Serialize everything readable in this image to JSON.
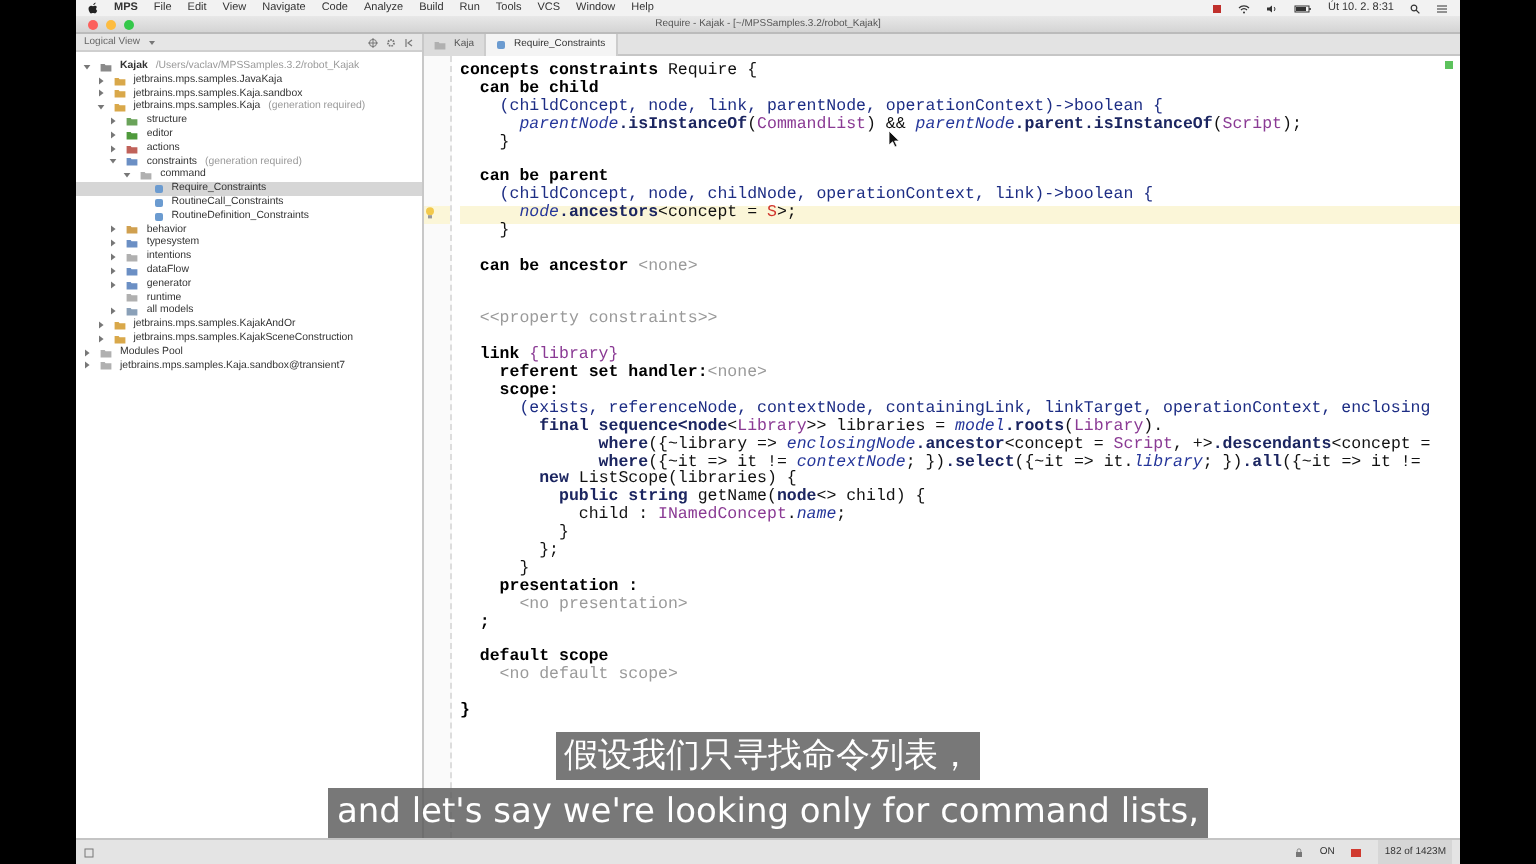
{
  "menu_bar": {
    "app": "MPS",
    "items": [
      "File",
      "Edit",
      "View",
      "Navigate",
      "Code",
      "Analyze",
      "Build",
      "Run",
      "Tools",
      "VCS",
      "Window",
      "Help"
    ],
    "clock": "Út 10. 2. 8:31"
  },
  "window": {
    "title": "Require - Kajak - [~/MPSSamples.3.2/robot_Kajak]"
  },
  "sidebar": {
    "view": "Logical View",
    "tree": [
      {
        "kind": "project",
        "label": "Kajak",
        "note": "/Users/vaclav/MPSSamples.3.2/robot_Kajak",
        "color": "#8a8a8a",
        "expanded": true,
        "selected": false,
        "children": [
          {
            "kind": "module",
            "label": "jetbrains.mps.samples.JavaKaja",
            "color": "#d9a84a",
            "expanded": false,
            "selected": false
          },
          {
            "kind": "module",
            "label": "jetbrains.mps.samples.Kaja.sandbox",
            "color": "#d9a84a",
            "expanded": false,
            "selected": false
          },
          {
            "kind": "module",
            "label": "jetbrains.mps.samples.Kaja",
            "note": "(generation required)",
            "color": "#d9a84a",
            "expanded": true,
            "selected": false,
            "children": [
              {
                "kind": "model",
                "label": "structure",
                "color": "#6aa35a",
                "expanded": false,
                "selected": false
              },
              {
                "kind": "model",
                "label": "editor",
                "color": "#4f9a3c",
                "expanded": false,
                "selected": false
              },
              {
                "kind": "model",
                "label": "actions",
                "color": "#c0625a",
                "expanded": false,
                "selected": false
              },
              {
                "kind": "model",
                "label": "constraints",
                "note": "(generation required)",
                "color": "#6b8fc4",
                "expanded": true,
                "selected": false,
                "children": [
                  {
                    "kind": "folder",
                    "label": "command",
                    "color": "#b0b0b0",
                    "expanded": true,
                    "selected": false,
                    "children": [
                      {
                        "kind": "node",
                        "label": "Require_Constraints",
                        "color": "#6b9bd0",
                        "selected": true
                      },
                      {
                        "kind": "node",
                        "label": "RoutineCall_Constraints",
                        "color": "#6b9bd0",
                        "selected": false
                      },
                      {
                        "kind": "node",
                        "label": "RoutineDefinition_Constraints",
                        "color": "#6b9bd0",
                        "selected": false
                      }
                    ]
                  }
                ]
              },
              {
                "kind": "model",
                "label": "behavior",
                "color": "#d0a050",
                "expanded": false,
                "selected": false
              },
              {
                "kind": "model",
                "label": "typesystem",
                "color": "#6b8fc4",
                "expanded": false,
                "selected": false
              },
              {
                "kind": "model",
                "label": "intentions",
                "color": "#b0b0b0",
                "expanded": false,
                "selected": false
              },
              {
                "kind": "model",
                "label": "dataFlow",
                "color": "#6b8fc4",
                "expanded": false,
                "selected": false
              },
              {
                "kind": "model",
                "label": "generator",
                "color": "#6b8fc4",
                "expanded": false,
                "selected": false
              },
              {
                "kind": "model",
                "label": "runtime",
                "color": "#b0b0b0",
                "selected": false
              },
              {
                "kind": "model",
                "label": "all models",
                "color": "#8aa0b8",
                "expanded": false,
                "selected": false
              }
            ]
          },
          {
            "kind": "module",
            "label": "jetbrains.mps.samples.KajakAndOr",
            "color": "#d9a84a",
            "expanded": false,
            "selected": false
          },
          {
            "kind": "module",
            "label": "jetbrains.mps.samples.KajakSceneConstruction",
            "color": "#d9a84a",
            "expanded": false,
            "selected": false
          }
        ]
      },
      {
        "kind": "pool",
        "label": "Modules Pool",
        "color": "#b0b0b0",
        "expanded": false,
        "selected": false
      },
      {
        "kind": "transient",
        "label": "jetbrains.mps.samples.Kaja.sandbox@transient7",
        "color": "#b0b0b0",
        "expanded": false,
        "selected": false
      }
    ]
  },
  "editor": {
    "tabs": [
      {
        "label": "Kaja",
        "kind": "model",
        "selected": false
      },
      {
        "label": "Require_Constraints",
        "kind": "node",
        "selected": true
      }
    ],
    "lines": [
      {
        "current": false,
        "tokens": [
          {
            "kind": "kw",
            "text": "concepts constraints "
          },
          {
            "kind": "p",
            "text": "Require {"
          }
        ]
      },
      {
        "current": false,
        "tokens": [
          {
            "kind": "kw",
            "text": "  can be child"
          }
        ]
      },
      {
        "current": false,
        "tokens": [
          {
            "kind": "n",
            "text": "    (childConcept, node, link, parentNode, operationContext)->boolean {"
          }
        ]
      },
      {
        "current": false,
        "tokens": [
          {
            "kind": "i",
            "text": "      parentNode"
          },
          {
            "kind": "b",
            "text": ".isInstanceOf"
          },
          {
            "kind": "p",
            "text": "("
          },
          {
            "kind": "r",
            "text": "CommandList"
          },
          {
            "kind": "p",
            "text": ") && "
          },
          {
            "kind": "i",
            "text": "parentNode"
          },
          {
            "kind": "b",
            "text": ".parent.isInstanceOf"
          },
          {
            "kind": "p",
            "text": "("
          },
          {
            "kind": "r",
            "text": "Script"
          },
          {
            "kind": "p",
            "text": ");"
          }
        ]
      },
      {
        "current": false,
        "tokens": [
          {
            "kind": "p",
            "text": "    }"
          }
        ]
      },
      {
        "current": false
      },
      {
        "current": false,
        "tokens": [
          {
            "kind": "kw",
            "text": "  can be parent"
          }
        ]
      },
      {
        "current": false,
        "tokens": [
          {
            "kind": "n",
            "text": "    (childConcept, node, childNode, operationContext, link)->boolean {"
          }
        ]
      },
      {
        "current": true,
        "tokens": [
          {
            "kind": "i",
            "text": "      node"
          },
          {
            "kind": "b",
            "text": ".ancestors"
          },
          {
            "kind": "p",
            "text": "<concept = "
          },
          {
            "kind": "e",
            "text": "S"
          },
          {
            "kind": "p",
            "text": ">;"
          }
        ]
      },
      {
        "current": false,
        "tokens": [
          {
            "kind": "p",
            "text": "    }"
          }
        ]
      },
      {
        "current": false
      },
      {
        "current": false,
        "tokens": [
          {
            "kind": "kw",
            "text": "  can be ancestor "
          },
          {
            "kind": "g",
            "text": "<none>"
          }
        ]
      },
      {
        "current": false
      },
      {
        "current": false
      },
      {
        "current": false,
        "tokens": [
          {
            "kind": "g",
            "text": "  <<property constraints>>"
          }
        ]
      },
      {
        "current": false
      },
      {
        "current": false,
        "tokens": [
          {
            "kind": "kw",
            "text": "  link "
          },
          {
            "kind": "r",
            "text": "{library}"
          }
        ]
      },
      {
        "current": false,
        "tokens": [
          {
            "kind": "kw",
            "text": "    referent set handler:"
          },
          {
            "kind": "g",
            "text": "<none>"
          }
        ]
      },
      {
        "current": false,
        "tokens": [
          {
            "kind": "kw",
            "text": "    scope:"
          }
        ]
      },
      {
        "current": false,
        "tokens": [
          {
            "kind": "n",
            "text": "      (exists, referenceNode, contextNode, containingLink, linkTarget, operationContext, enclosing"
          }
        ]
      },
      {
        "current": false,
        "tokens": [
          {
            "kind": "b",
            "text": "        final sequence<node"
          },
          {
            "kind": "p",
            "text": "<"
          },
          {
            "kind": "r",
            "text": "Library"
          },
          {
            "kind": "p",
            "text": ">> libraries = "
          },
          {
            "kind": "i",
            "text": "model"
          },
          {
            "kind": "b",
            "text": ".roots"
          },
          {
            "kind": "p",
            "text": "("
          },
          {
            "kind": "r",
            "text": "Library"
          },
          {
            "kind": "p",
            "text": ")."
          }
        ]
      },
      {
        "current": false,
        "tokens": [
          {
            "kind": "b",
            "text": "              where"
          },
          {
            "kind": "p",
            "text": "({~library => "
          },
          {
            "kind": "i",
            "text": "enclosingNode"
          },
          {
            "kind": "b",
            "text": ".ancestor"
          },
          {
            "kind": "p",
            "text": "<concept = "
          },
          {
            "kind": "r",
            "text": "Script"
          },
          {
            "kind": "p",
            "text": ", +>"
          },
          {
            "kind": "b",
            "text": ".descendants"
          },
          {
            "kind": "p",
            "text": "<concept ="
          }
        ]
      },
      {
        "current": false,
        "tokens": [
          {
            "kind": "b",
            "text": "              where"
          },
          {
            "kind": "p",
            "text": "({~it => it != "
          },
          {
            "kind": "i",
            "text": "contextNode"
          },
          {
            "kind": "p",
            "text": "; })"
          },
          {
            "kind": "b",
            "text": ".select"
          },
          {
            "kind": "p",
            "text": "({~it => it."
          },
          {
            "kind": "i",
            "text": "library"
          },
          {
            "kind": "p",
            "text": "; })"
          },
          {
            "kind": "b",
            "text": ".all"
          },
          {
            "kind": "p",
            "text": "({~it => it !="
          }
        ]
      },
      {
        "current": false,
        "tokens": [
          {
            "kind": "b",
            "text": "        new "
          },
          {
            "kind": "p",
            "text": "ListScope(libraries) {"
          }
        ]
      },
      {
        "current": false,
        "tokens": [
          {
            "kind": "b",
            "text": "          public string "
          },
          {
            "kind": "p",
            "text": "getName("
          },
          {
            "kind": "b",
            "text": "node"
          },
          {
            "kind": "p",
            "text": "<> child) {"
          }
        ]
      },
      {
        "current": false,
        "tokens": [
          {
            "kind": "p",
            "text": "            child : "
          },
          {
            "kind": "r",
            "text": "INamedConcept"
          },
          {
            "kind": "p",
            "text": "."
          },
          {
            "kind": "i",
            "text": "name"
          },
          {
            "kind": "p",
            "text": ";"
          }
        ]
      },
      {
        "current": false,
        "tokens": [
          {
            "kind": "p",
            "text": "          }"
          }
        ]
      },
      {
        "current": false,
        "tokens": [
          {
            "kind": "p",
            "text": "        };"
          }
        ]
      },
      {
        "current": false,
        "tokens": [
          {
            "kind": "p",
            "text": "      }"
          }
        ]
      },
      {
        "current": false,
        "tokens": [
          {
            "kind": "kw",
            "text": "    presentation :"
          }
        ]
      },
      {
        "current": false,
        "tokens": [
          {
            "kind": "g",
            "text": "      <no presentation>"
          }
        ]
      },
      {
        "current": false,
        "tokens": [
          {
            "kind": "kw",
            "text": "  ;"
          }
        ]
      },
      {
        "current": false
      },
      {
        "current": false,
        "tokens": [
          {
            "kind": "kw",
            "text": "  default scope"
          }
        ]
      },
      {
        "current": false,
        "tokens": [
          {
            "kind": "g",
            "text": "    <no default scope>"
          }
        ]
      },
      {
        "current": false
      },
      {
        "current": false,
        "tokens": [
          {
            "kind": "kw",
            "text": "}"
          }
        ]
      }
    ]
  },
  "status_bar": {
    "insert_mode": "ON",
    "memory": "182 of 1423M"
  },
  "subtitles": [
    {
      "kind": "upper",
      "text": "假设我们只寻找命令列表，"
    },
    {
      "kind": "lower",
      "text": "and let's say we're looking only for command lists,"
    }
  ]
}
